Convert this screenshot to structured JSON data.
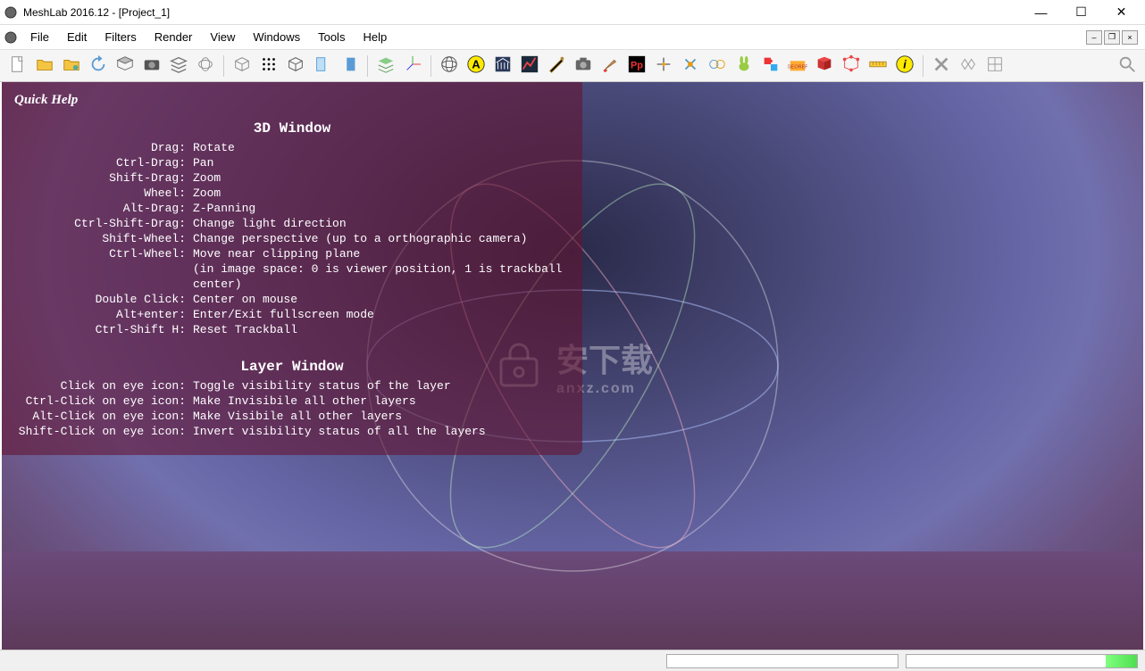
{
  "window": {
    "title": "MeshLab 2016.12 - [Project_1]"
  },
  "menu": {
    "items": [
      "File",
      "Edit",
      "Filters",
      "Render",
      "View",
      "Windows",
      "Tools",
      "Help"
    ]
  },
  "toolbar_icons": [
    "new-file",
    "open-folder",
    "open-project",
    "reload",
    "import",
    "camera",
    "layers",
    "merge",
    "sep",
    "bbox",
    "points",
    "wireframe",
    "fill-light",
    "flat-shading",
    "sep",
    "layers2",
    "axis",
    "sep",
    "globe",
    "letter-a",
    "museum",
    "plot",
    "knife",
    "snapshot",
    "paint",
    "pp",
    "align",
    "register",
    "pair",
    "rabbit",
    "puzzle",
    "georef",
    "select-face",
    "select-vert",
    "ruler",
    "info",
    "sep",
    "edit-x",
    "edit-wire",
    "edit-mesh"
  ],
  "quickhelp": {
    "title": "Quick Help",
    "sections": [
      {
        "title": "3D Window",
        "rows": [
          {
            "k": "Drag:",
            "v": "Rotate"
          },
          {
            "k": "Ctrl-Drag:",
            "v": "Pan"
          },
          {
            "k": "Shift-Drag:",
            "v": "Zoom"
          },
          {
            "k": "Wheel:",
            "v": "Zoom"
          },
          {
            "k": "Alt-Drag:",
            "v": "Z-Panning"
          },
          {
            "k": "Ctrl-Shift-Drag:",
            "v": "Change light direction"
          },
          {
            "k": "Shift-Wheel:",
            "v": "Change perspective (up to a orthographic camera)"
          },
          {
            "k": "Ctrl-Wheel:",
            "v": "Move near clipping plane"
          },
          {
            "k": "",
            "v": "(in image space: 0 is viewer position, 1 is trackball center)",
            "sub": true
          },
          {
            "k": "Double Click:",
            "v": "Center on mouse"
          },
          {
            "k": "Alt+enter:",
            "v": "Enter/Exit fullscreen mode"
          },
          {
            "k": "Ctrl-Shift H:",
            "v": "Reset Trackball"
          }
        ]
      },
      {
        "title": "Layer Window",
        "rows": [
          {
            "k": "Click on eye icon:",
            "v": "Toggle visibility status of the layer"
          },
          {
            "k": "Ctrl-Click on eye icon:",
            "v": "Make Invisibile all other layers"
          },
          {
            "k": "Alt-Click on eye icon:",
            "v": "Make Visibile all other layers"
          },
          {
            "k": "Shift-Click on eye icon:",
            "v": "Invert visibility status of all the layers"
          }
        ]
      }
    ]
  },
  "watermark": {
    "text": "安下载",
    "sub": "anxz.com"
  }
}
